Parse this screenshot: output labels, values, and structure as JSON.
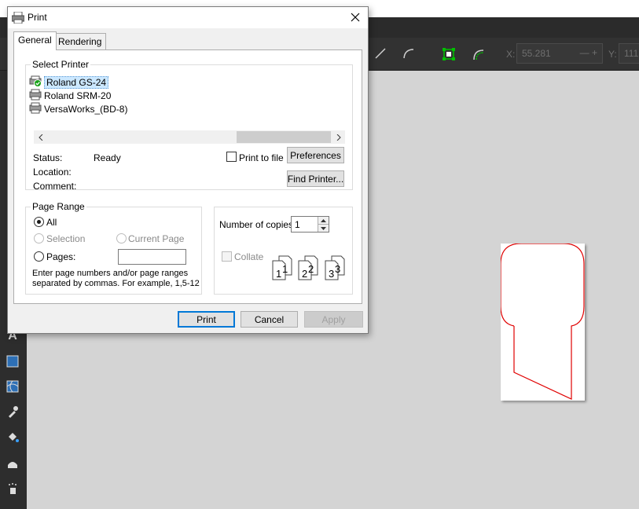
{
  "dialog": {
    "title": "Print",
    "tabs": [
      {
        "label": "General",
        "active": true
      },
      {
        "label": "Rendering",
        "active": false
      }
    ],
    "select_printer": {
      "legend": "Select Printer",
      "printers": [
        {
          "name": "Roland GS-24",
          "selected": true,
          "icon": "printer-default-icon"
        },
        {
          "name": "Roland SRM-20",
          "selected": false,
          "icon": "printer-icon"
        },
        {
          "name": "VersaWorks_(BD-8)",
          "selected": false,
          "icon": "printer-icon"
        }
      ],
      "status_label": "Status:",
      "status_value": "Ready",
      "location_label": "Location:",
      "comment_label": "Comment:",
      "print_to_file_label": "Print to file",
      "preferences_button": "Preferences",
      "find_printer_button": "Find Printer..."
    },
    "page_range": {
      "legend": "Page Range",
      "all_label": "All",
      "selection_label": "Selection",
      "current_page_label": "Current Page",
      "pages_label": "Pages:",
      "pages_value": "",
      "hint": "Enter page numbers and/or page ranges separated by commas.  For example, 1,5-12"
    },
    "copies": {
      "label": "Number of copies:",
      "value": "1",
      "collate_label": "Collate",
      "stack_numbers": [
        "1",
        "1",
        "2",
        "2",
        "3",
        "3"
      ]
    },
    "buttons": {
      "print": "Print",
      "cancel": "Cancel",
      "apply": "Apply"
    }
  },
  "background_app": {
    "x_label": "X:",
    "x_value": "55.281",
    "y_label": "Y:",
    "y_value": "111",
    "accent_color": "#00c000",
    "shape_color": "#e00000"
  }
}
